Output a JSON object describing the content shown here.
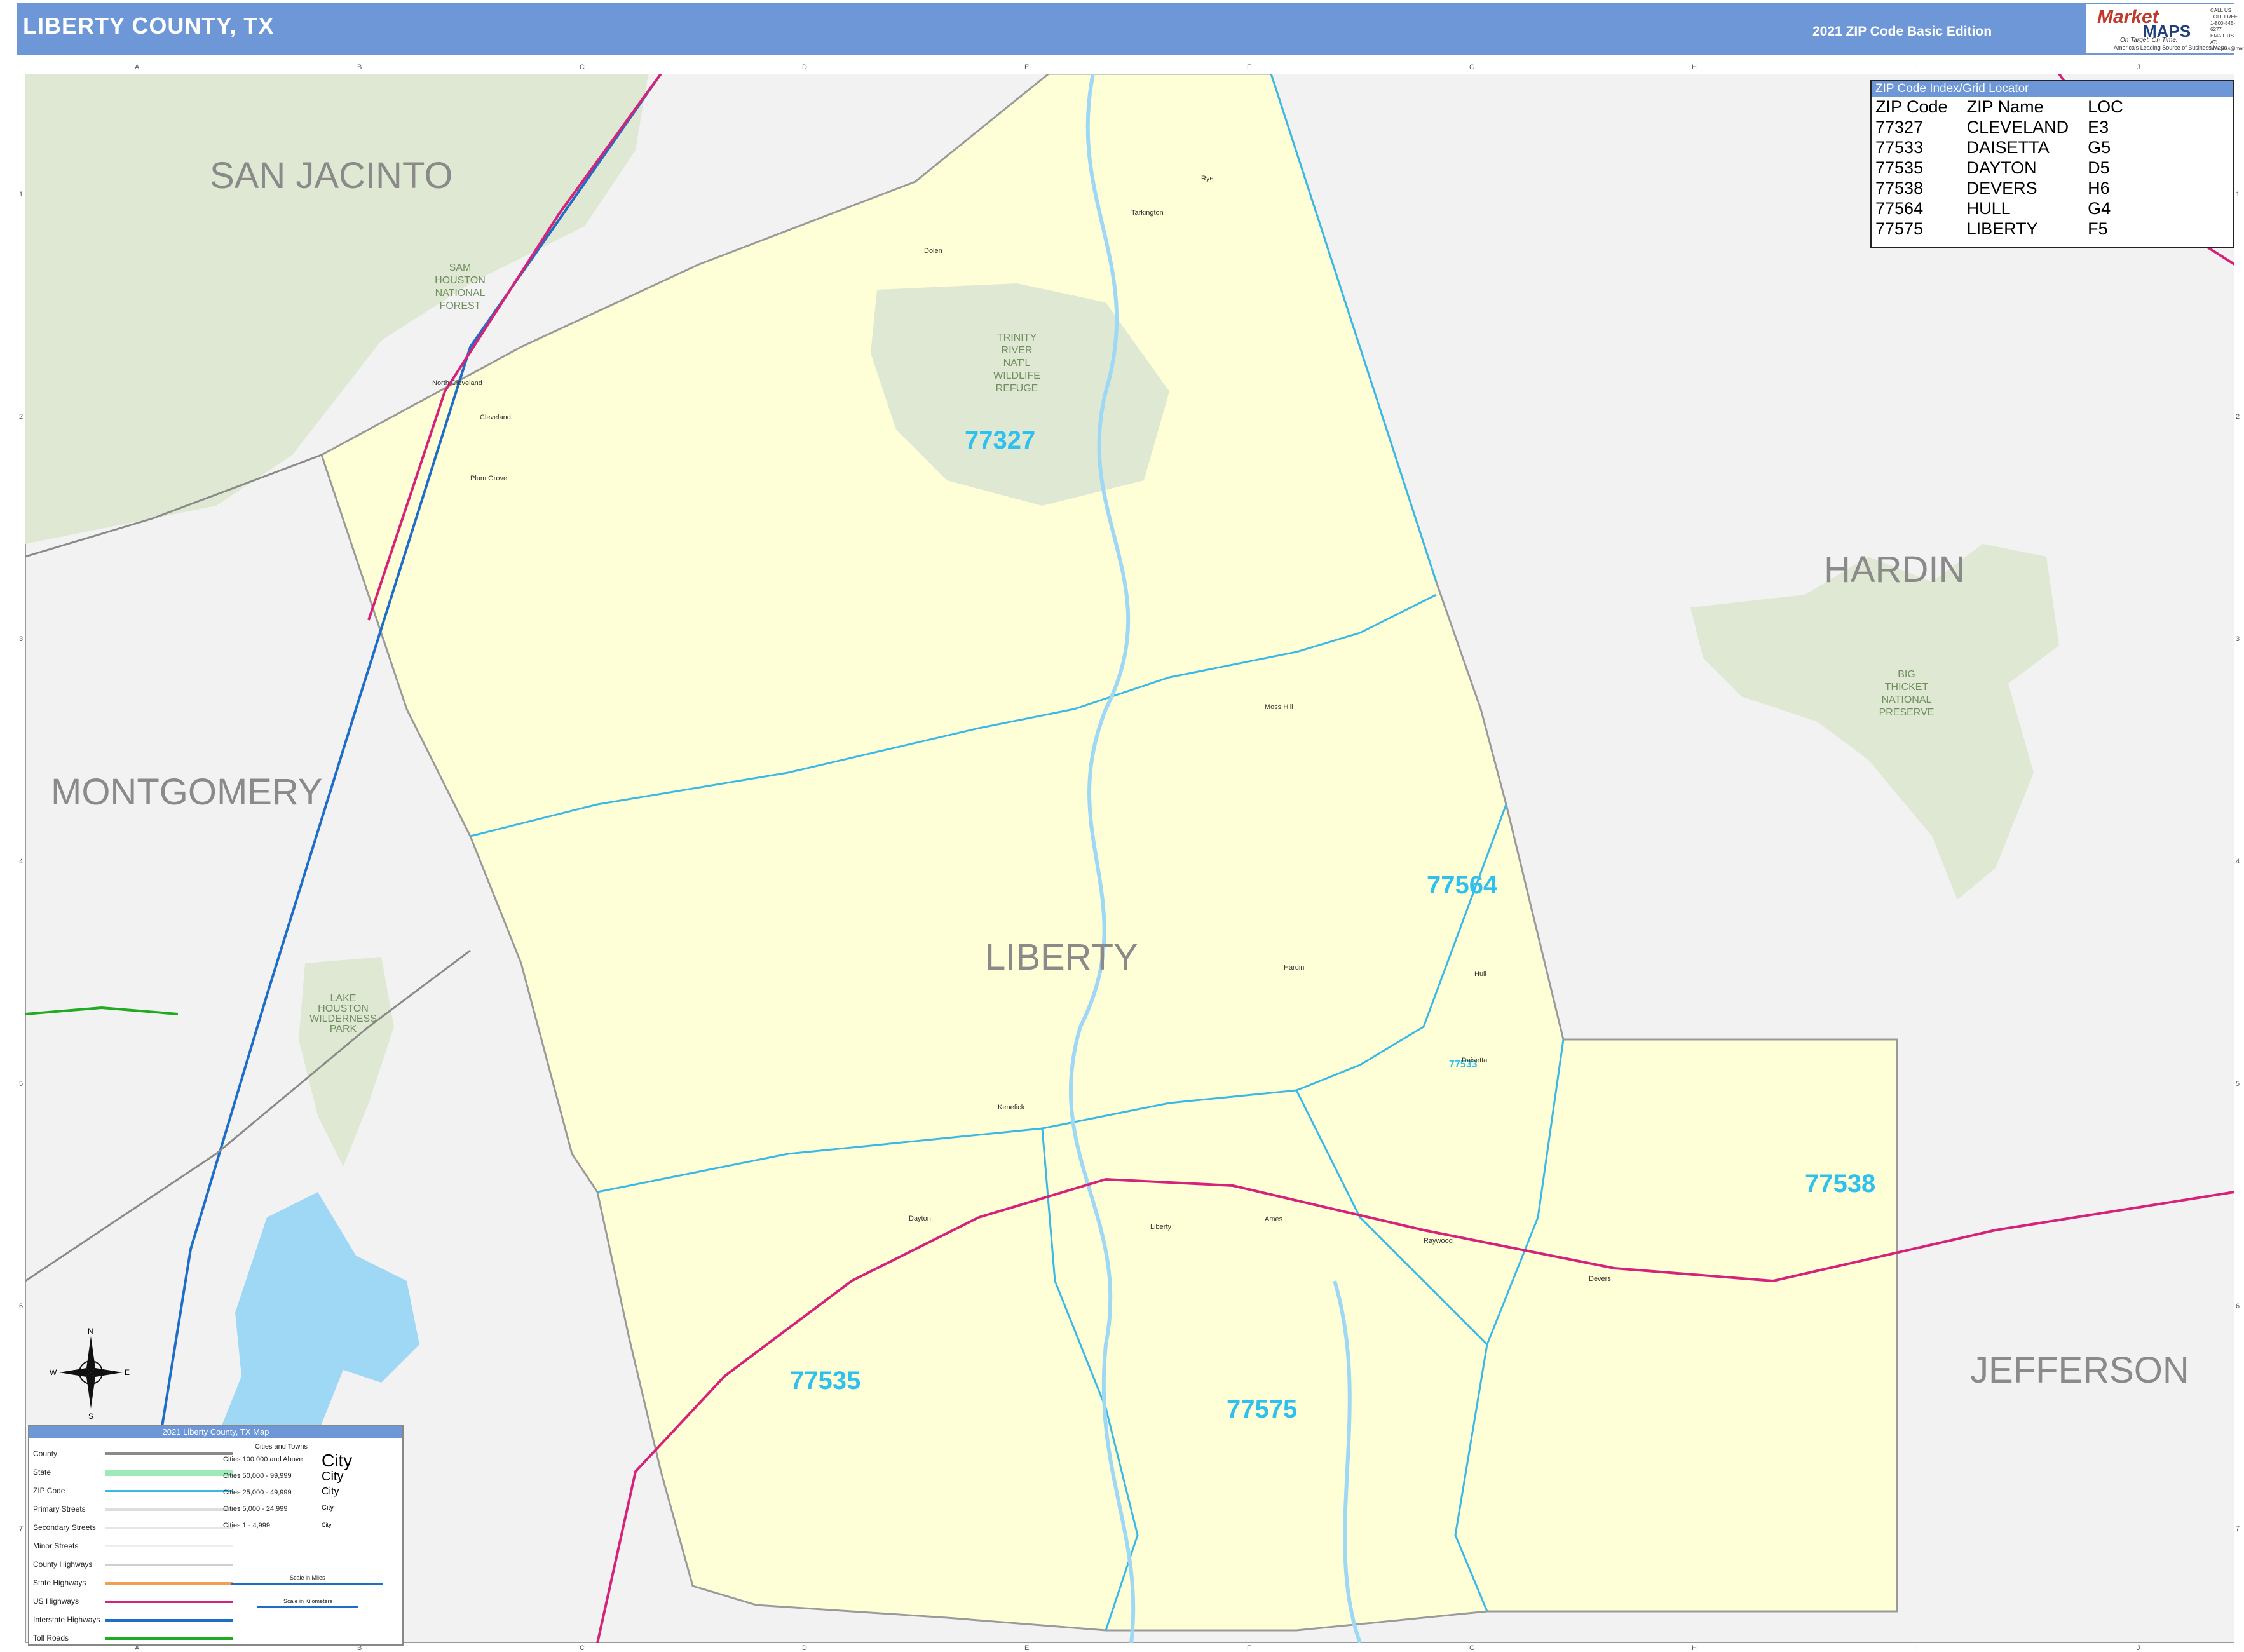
{
  "header": {
    "title": "LIBERTY COUNTY, TX",
    "edition": "2021 ZIP Code Basic Edition"
  },
  "logo": {
    "brand": "Market",
    "brand2": "MAPS",
    "tagline": "On Target. On Time.",
    "tagline2": "America's Leading Source of Business Maps",
    "contact": "CALL US TOLL FREE 1-800-845-6277 · EMAIL US AT: business@marketmaps.com"
  },
  "grid": {
    "columns": [
      "A",
      "B",
      "C",
      "D",
      "E",
      "F",
      "G",
      "H",
      "I",
      "J"
    ],
    "rows": [
      "1",
      "2",
      "3",
      "4",
      "5",
      "6",
      "7"
    ]
  },
  "counties": {
    "san_jacinto": "SAN JACINTO",
    "montgomery": "MONTGOMERY",
    "hardin": "HARDIN",
    "jefferson": "JEFFERSON",
    "liberty": "LIBERTY"
  },
  "parks": {
    "sam_houston": [
      "SAM",
      "HOUSTON",
      "NATIONAL",
      "FOREST"
    ],
    "trinity": [
      "TRINITY",
      "RIVER",
      "NAT'L",
      "WILDLIFE",
      "REFUGE"
    ],
    "big_thicket": [
      "BIG",
      "THICKET",
      "NATIONAL",
      "PRESERVE"
    ],
    "lake_houston": [
      "LAKE",
      "HOUSTON",
      "WILDERNESS",
      "PARK"
    ]
  },
  "zip_labels": {
    "z77327": "77327",
    "z77564": "77564",
    "z77538": "77538",
    "z77535": "77535",
    "z77575": "77575",
    "z77533": "77533"
  },
  "towns": {
    "cleveland": "Cleveland",
    "north_cleveland": "North Cleveland",
    "plum_grove": "Plum Grove",
    "dayton": "Dayton",
    "liberty": "Liberty",
    "daisetta": "Daisetta",
    "hull": "Hull",
    "devers": "Devers",
    "hardin": "Hardin",
    "ames": "Ames",
    "kenefick": "Kenefick",
    "raywood": "Raywood",
    "moss_hill": "Moss Hill",
    "tarkington": "Tarkington",
    "rye": "Rye",
    "dolen": "Dolen"
  },
  "zip_index": {
    "title": "ZIP Code Index/Grid Locator",
    "columns": [
      "ZIP Code",
      "ZIP Name",
      "LOC"
    ],
    "rows": [
      [
        "77327",
        "CLEVELAND",
        "E3"
      ],
      [
        "77533",
        "DAISETTA",
        "G5"
      ],
      [
        "77535",
        "DAYTON",
        "D5"
      ],
      [
        "77538",
        "DEVERS",
        "H6"
      ],
      [
        "77564",
        "HULL",
        "G4"
      ],
      [
        "77575",
        "LIBERTY",
        "F5"
      ]
    ]
  },
  "legend": {
    "title": "2021 Liberty County, TX Map",
    "items": [
      "County",
      "State",
      "ZIP Code",
      "Primary Streets",
      "Secondary Streets",
      "Minor Streets",
      "County Highways",
      "State Highways",
      "US Highways",
      "Interstate Highways",
      "Toll Roads"
    ],
    "colors": [
      "#8a8a8a",
      "#9fe8b8",
      "#39b9e6",
      "#e0e0e0",
      "#e8e8e8",
      "#eeeeee",
      "#cfcfcf",
      "#f0a050",
      "#d6237a",
      "#1e6ec8",
      "#22aa22"
    ],
    "cities_title": "Cities and Towns",
    "city_classes": [
      "Cities 100,000 and Above",
      "Cities 50,000 - 99,999",
      "Cities 25,000 - 49,999",
      "Cities 5,000 - 24,999",
      "Cities 1 - 4,999"
    ],
    "city_example": "City",
    "scale_miles": "Scale in Miles",
    "scale_km": "Scale in Kilometers"
  },
  "compass": {
    "n": "N",
    "s": "S",
    "e": "E",
    "w": "W"
  }
}
